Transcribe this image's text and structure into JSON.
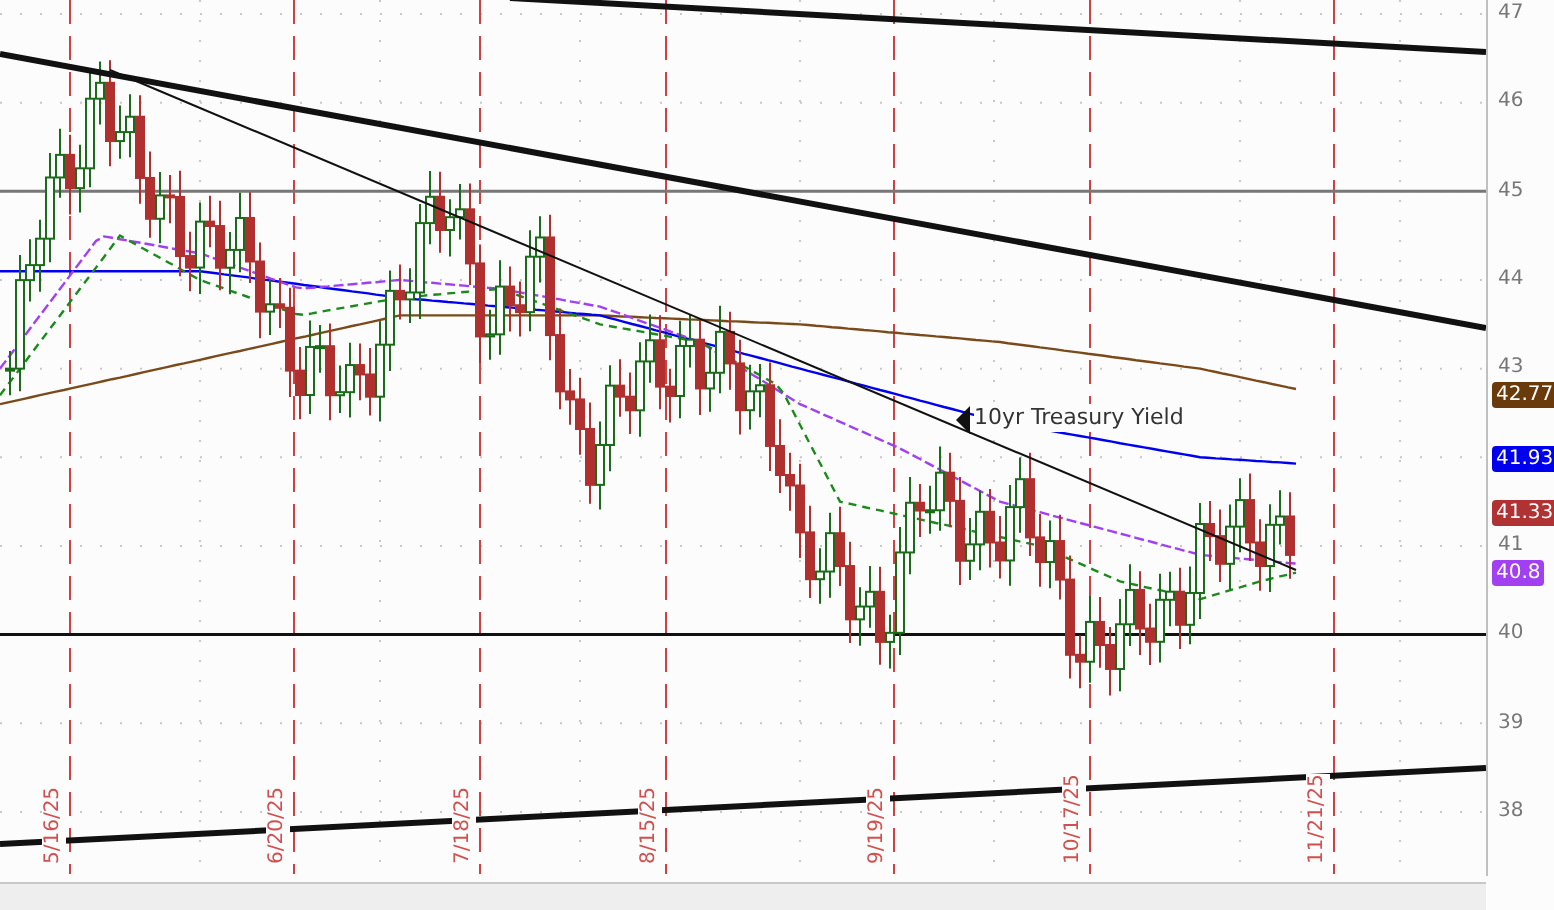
{
  "chart": {
    "annotation": "10yr Treasury Yield",
    "y_axis_labels": [
      "47",
      "46",
      "45",
      "44",
      "43",
      "41",
      "40",
      "39",
      "38"
    ],
    "date_labels": [
      "5/16/25",
      "6/20/25",
      "7/18/25",
      "8/15/25",
      "9/19/25",
      "10/17/25",
      "11/21/25"
    ],
    "price_tags": [
      {
        "value": "42.77",
        "color": "#6b3a0a"
      },
      {
        "value": "41.93",
        "color": "#0000ee"
      },
      {
        "value": "41.33",
        "color": "#b03232"
      },
      {
        "value": "40.8",
        "color": "#a040f0"
      }
    ]
  }
}
